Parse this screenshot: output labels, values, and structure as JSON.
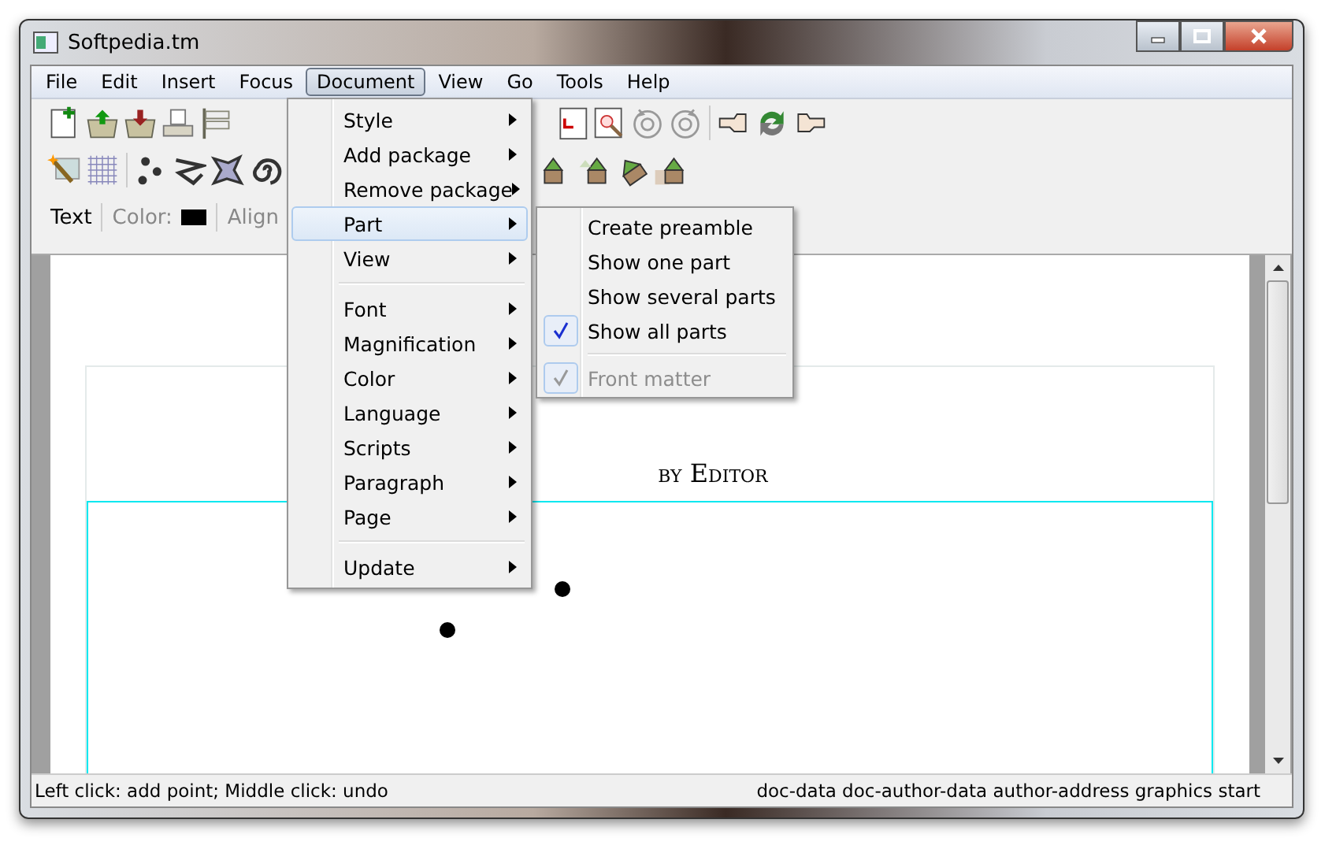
{
  "window": {
    "title": "Softpedia.tm"
  },
  "menubar": [
    {
      "label": "File",
      "selected": false
    },
    {
      "label": "Edit",
      "selected": false
    },
    {
      "label": "Insert",
      "selected": false
    },
    {
      "label": "Focus",
      "selected": false
    },
    {
      "label": "Document",
      "selected": true
    },
    {
      "label": "View",
      "selected": false
    },
    {
      "label": "Go",
      "selected": false
    },
    {
      "label": "Tools",
      "selected": false
    },
    {
      "label": "Help",
      "selected": false
    }
  ],
  "format_bar": {
    "mode": "Text",
    "color_label": "Color:",
    "color": "#000000",
    "alignment_label": "Align"
  },
  "document": {
    "byline": "by Editor"
  },
  "menu": [
    {
      "kind": "item",
      "label": "Style",
      "submenu": true,
      "selected": false
    },
    {
      "kind": "item",
      "label": "Add package",
      "submenu": true,
      "selected": false
    },
    {
      "kind": "item",
      "label": "Remove package",
      "submenu": true,
      "selected": false
    },
    {
      "kind": "item",
      "label": "Part",
      "submenu": true,
      "selected": true
    },
    {
      "kind": "item",
      "label": "View",
      "submenu": true,
      "selected": false
    },
    {
      "kind": "separator"
    },
    {
      "kind": "item",
      "label": "Font",
      "submenu": true,
      "selected": false
    },
    {
      "kind": "item",
      "label": "Magnification",
      "submenu": true,
      "selected": false
    },
    {
      "kind": "item",
      "label": "Color",
      "submenu": true,
      "selected": false
    },
    {
      "kind": "item",
      "label": "Language",
      "submenu": true,
      "selected": false
    },
    {
      "kind": "item",
      "label": "Scripts",
      "submenu": true,
      "selected": false
    },
    {
      "kind": "item",
      "label": "Paragraph",
      "submenu": true,
      "selected": false
    },
    {
      "kind": "item",
      "label": "Page",
      "submenu": true,
      "selected": false
    },
    {
      "kind": "separator"
    },
    {
      "kind": "item",
      "label": "Update",
      "submenu": true,
      "selected": false
    }
  ],
  "submenu": [
    {
      "kind": "item",
      "label": "Create preamble",
      "checked": false,
      "disabled": false
    },
    {
      "kind": "item",
      "label": "Show one part",
      "checked": false,
      "disabled": false
    },
    {
      "kind": "item",
      "label": "Show several parts",
      "checked": false,
      "disabled": false
    },
    {
      "kind": "item",
      "label": "Show all parts",
      "checked": true,
      "disabled": false
    },
    {
      "kind": "separator"
    },
    {
      "kind": "item",
      "label": "Front matter",
      "checked": true,
      "disabled": true
    }
  ],
  "status_bar": {
    "left": "Left click: add point; Middle click: undo",
    "right": "doc-data doc-author-data author-address  graphics start"
  }
}
